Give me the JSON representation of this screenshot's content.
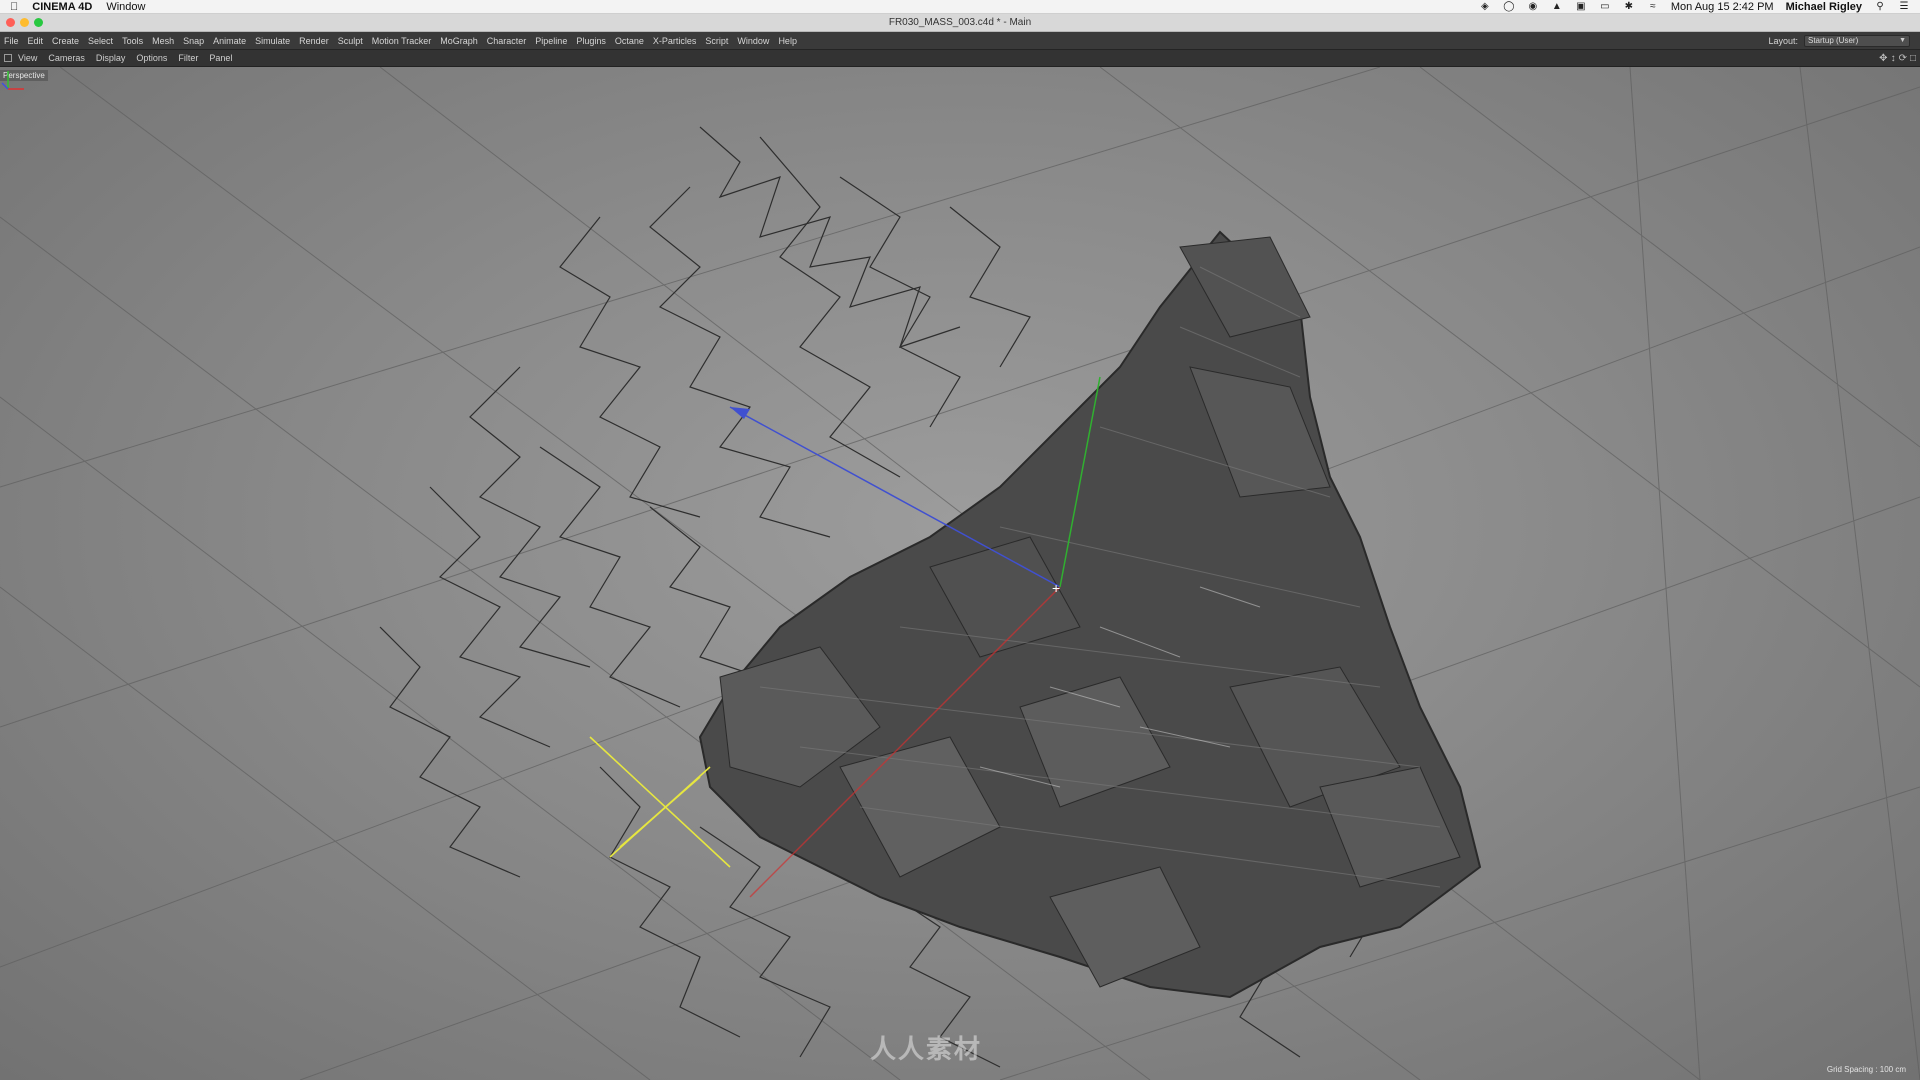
{
  "mac_menubar": {
    "app_name": "CINEMA 4D",
    "menu_item": "Window",
    "clock": "Mon Aug 15  2:42 PM",
    "user": "Michael Rigley",
    "status_icons": [
      "dropbox-icon",
      "bulb-icon",
      "eye-icon",
      "flame-icon",
      "nvidia-icon",
      "airplay-icon",
      "bluetooth-icon",
      "wifi-icon",
      "search-icon",
      "list-icon"
    ]
  },
  "window": {
    "title": "FR030_MASS_003.c4d * - Main"
  },
  "main_menu": {
    "items": [
      "File",
      "Edit",
      "Create",
      "Select",
      "Tools",
      "Mesh",
      "Snap",
      "Animate",
      "Simulate",
      "Render",
      "Sculpt",
      "Motion Tracker",
      "MoGraph",
      "Character",
      "Pipeline",
      "Plugins",
      "Octane",
      "X-Particles",
      "Script",
      "Window",
      "Help"
    ],
    "layout_label": "Layout:",
    "layout_value": "Startup (User)"
  },
  "view_menu": {
    "items": [
      "View",
      "Cameras",
      "Display",
      "Options",
      "Filter",
      "Panel"
    ]
  },
  "viewport": {
    "camera_label": "Perspective",
    "grid_spacing": "Grid Spacing : 100 cm",
    "watermark": "人人素材"
  },
  "colors": {
    "menubar_bg": "#3a3a3a",
    "viewport_bg": "#8f8f8f",
    "mesh": "#3b3b3b",
    "axis_x": "#e03030",
    "axis_y": "#30c030",
    "axis_z": "#3050e0",
    "null_object": "#e8e840"
  }
}
